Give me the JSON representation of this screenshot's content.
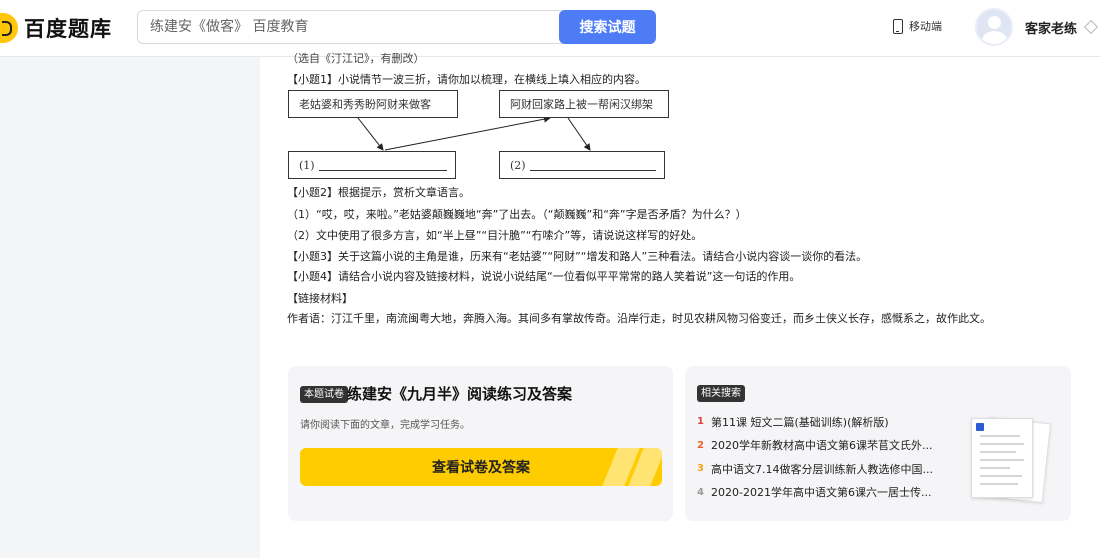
{
  "header": {
    "logo_text": "百度题库",
    "search_placeholder": "练建安《做客》 百度教育",
    "search_button": "搜索试题",
    "mobile_label": "移动端",
    "username": "客家老练"
  },
  "question": {
    "cut_line": "（选自《汀江记》，有删改）",
    "q1": "【小题1】小说情节一波三折，请你加以梳理，在横线上填入相应的内容。",
    "flow": {
      "box_a": "老姑婆和秀秀盼阿财来做客",
      "box_b": "阿财回家路上被一帮闲汉绑架",
      "box_c": "(1)",
      "box_d": "(2)"
    },
    "q2": "【小题2】根据提示，赏析文章语言。",
    "q2_1": "（1）“哎，哎，来啦。”老姑婆颠巍巍地“奔”了出去。（“颠巍巍”和“奔”字是否矛盾？为什么？）",
    "q2_2": "（2）文中使用了很多方言，如“半上昼”“目汁脆”“冇嗦介”等，请说说这样写的好处。",
    "q3": "【小题3】关于这篇小说的主角是谁，历来有“老姑婆”“阿财”“增发和路人”三种看法。请结合小说内容谈一谈你的看法。",
    "q4": "【小题4】请结合小说内容及链接材料，说说小说结尾“一位看似平平常常的路人笑着说”这一句话的作用。",
    "link_title": "【链接材料】",
    "link_body": "作者语：汀江千里，南流闽粤大地，奔腾入海。其间多有掌故传奇。沿岸行走，时见农耕风物习俗变迁，而乡土侠义长存，感慨系之，故作此文。"
  },
  "paper_card": {
    "tag": "本题试卷",
    "title": "练建安《九月半》阅读练习及答案",
    "desc": "请你阅读下面的文章，完成学习任务。",
    "button": "查看试卷及答案"
  },
  "related": {
    "tag": "相关搜索",
    "items": [
      {
        "num": "1",
        "text": "第11课 短文二篇(基础训练)(解析版)"
      },
      {
        "num": "2",
        "text": "2020学年新教材高中语文第6课芣苢文氏外..."
      },
      {
        "num": "3",
        "text": "高中语文7.14做客分层训练新人教选修中国..."
      },
      {
        "num": "4",
        "text": "2020-2021学年高中语文第6课六一居士传..."
      }
    ]
  },
  "colors": {
    "accent_blue": "#4e7cf6",
    "brand_yellow": "#ffcc00",
    "rank1": "#e23d3d",
    "rank2": "#f0602c",
    "rank3": "#f4a21a"
  }
}
